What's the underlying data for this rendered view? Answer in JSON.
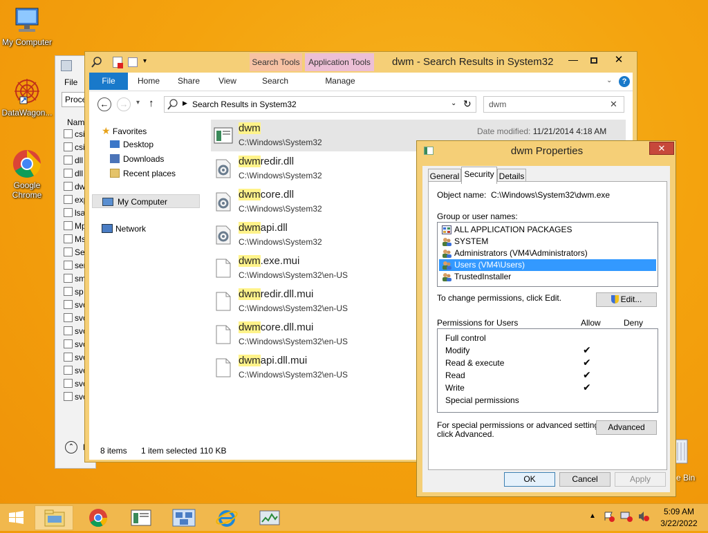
{
  "desktop": {
    "icons": [
      {
        "label": "My Computer"
      },
      {
        "label": "DataWagon..."
      },
      {
        "label": "Google Chrome"
      }
    ],
    "recycle_label": "e Bin"
  },
  "bg_window": {
    "file_label": "File",
    "col_label": "Proce",
    "name_label": "Nam",
    "rows": [
      "csi",
      "csi",
      "dll",
      "dll",
      "dw",
      "exp",
      "lsa",
      "Mp",
      "Ms",
      "Se",
      "ser",
      "sm",
      "sp",
      "svc",
      "svc",
      "svc",
      "svc",
      "svc",
      "svc",
      "svc",
      "svc"
    ],
    "bottom_letter": "l"
  },
  "explorer": {
    "title": "dwm - Search Results in System32",
    "ctx_search_tools": "Search Tools",
    "ctx_application_tools": "Application Tools",
    "tabs": {
      "file": "File",
      "home": "Home",
      "share": "Share",
      "view": "View",
      "search": "Search",
      "manage": "Manage"
    },
    "address": "Search Results in System32",
    "search_value": "dwm",
    "nav": {
      "favorites": "Favorites",
      "desktop": "Desktop",
      "downloads": "Downloads",
      "recent": "Recent places",
      "computer": "My Computer",
      "network": "Network"
    },
    "date_modified_label": "Date modified:",
    "date_modified_value": "11/21/2014 4:18 AM",
    "items": [
      {
        "hl": "dwm",
        "rest": "",
        "path": "C:\\Windows\\System32"
      },
      {
        "hl": "dwm",
        "rest": "redir.dll",
        "path": "C:\\Windows\\System32"
      },
      {
        "hl": "dwm",
        "rest": "core.dll",
        "path": "C:\\Windows\\System32"
      },
      {
        "hl": "dwm",
        "rest": "api.dll",
        "path": "C:\\Windows\\System32"
      },
      {
        "hl": "dwm",
        "rest": ".exe.mui",
        "path": "C:\\Windows\\System32\\en-US"
      },
      {
        "hl": "dwm",
        "rest": "redir.dll.mui",
        "path": "C:\\Windows\\System32\\en-US"
      },
      {
        "hl": "dwm",
        "rest": "core.dll.mui",
        "path": "C:\\Windows\\System32\\en-US"
      },
      {
        "hl": "dwm",
        "rest": "api.dll.mui",
        "path": "C:\\Windows\\System32\\en-US"
      }
    ],
    "status": {
      "count": "8 items",
      "selected": "1 item selected",
      "size": "110 KB"
    }
  },
  "dialog": {
    "title": "dwm Properties",
    "tabs": {
      "general": "General",
      "security": "Security",
      "details": "Details"
    },
    "object_name_label": "Object name:",
    "object_name_value": "C:\\Windows\\System32\\dwm.exe",
    "group_label": "Group or user names:",
    "users": [
      "ALL APPLICATION PACKAGES",
      "SYSTEM",
      "Administrators (VM4\\Administrators)",
      "Users (VM4\\Users)",
      "TrustedInstaller"
    ],
    "change_text": "To change permissions, click Edit.",
    "edit_button": "Edit...",
    "perms_label": "Permissions for Users",
    "allow_label": "Allow",
    "deny_label": "Deny",
    "permissions": [
      {
        "name": "Full control",
        "allow": ""
      },
      {
        "name": "Modify",
        "allow": "✔"
      },
      {
        "name": "Read & execute",
        "allow": "✔"
      },
      {
        "name": "Read",
        "allow": "✔"
      },
      {
        "name": "Write",
        "allow": "✔"
      },
      {
        "name": "Special permissions",
        "allow": ""
      }
    ],
    "special_text_1": "For special permissions or advanced settings,",
    "special_text_2": "click Advanced.",
    "advanced_button": "Advanced",
    "ok_button": "OK",
    "cancel_button": "Cancel",
    "apply_button": "Apply"
  },
  "taskbar": {
    "time": "5:09 AM",
    "date": "3/22/2022"
  }
}
